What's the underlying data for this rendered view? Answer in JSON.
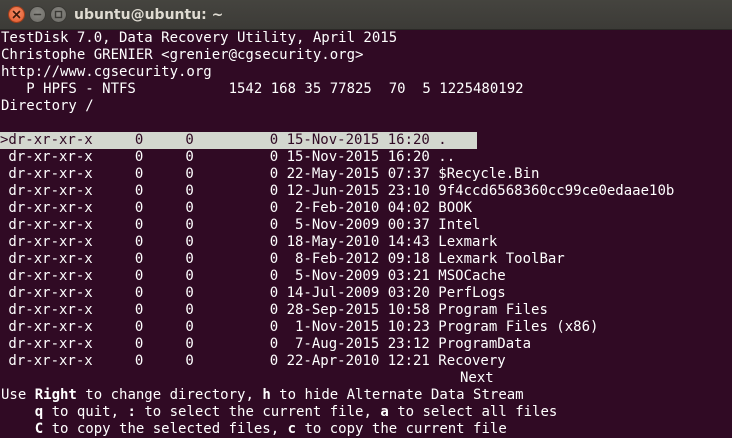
{
  "window": {
    "title": "ubuntu@ubuntu: ~"
  },
  "header": {
    "line1": "TestDisk 7.0, Data Recovery Utility, April 2015",
    "line2": "Christophe GRENIER <grenier@cgsecurity.org>",
    "line3": "http://www.cgsecurity.org",
    "partition": "   P HPFS - NTFS           1542 168 35 77825  70  5 1225480192",
    "directory": "Directory /"
  },
  "listing": [
    {
      "text": ">dr-xr-xr-x     0     0         0 15-Nov-2015 16:20 ."
    },
    {
      "text": " dr-xr-xr-x     0     0         0 15-Nov-2015 16:20 .."
    },
    {
      "text": " dr-xr-xr-x     0     0         0 22-May-2015 07:37 $Recycle.Bin"
    },
    {
      "text": " dr-xr-xr-x     0     0         0 12-Jun-2015 23:10 9f4ccd6568360cc99ce0edaae10b"
    },
    {
      "text": " dr-xr-xr-x     0     0         0  2-Feb-2010 04:02 BOOK"
    },
    {
      "text": " dr-xr-xr-x     0     0         0  5-Nov-2009 00:37 Intel"
    },
    {
      "text": " dr-xr-xr-x     0     0         0 18-May-2010 14:43 Lexmark"
    },
    {
      "text": " dr-xr-xr-x     0     0         0  8-Feb-2012 09:18 Lexmark ToolBar"
    },
    {
      "text": " dr-xr-xr-x     0     0         0  5-Nov-2009 03:21 MSOCache"
    },
    {
      "text": " dr-xr-xr-x     0     0         0 14-Jul-2009 03:20 PerfLogs"
    },
    {
      "text": " dr-xr-xr-x     0     0         0 28-Sep-2015 10:58 Program Files"
    },
    {
      "text": " dr-xr-xr-x     0     0         0  1-Nov-2015 10:23 Program Files (x86)"
    },
    {
      "text": " dr-xr-xr-x     0     0         0  7-Aug-2015 23:12 ProgramData"
    },
    {
      "text": " dr-xr-xr-x     0     0         0 22-Apr-2010 12:21 Recovery"
    }
  ],
  "next": "Next",
  "help": {
    "l1_pre": "Use ",
    "l1_key1": "Right",
    "l1_mid": " to change directory, ",
    "l1_key2": "h",
    "l1_post": " to hide Alternate Data Stream",
    "l2_pre": "    ",
    "l2_key1": "q",
    "l2_mid1": " to quit, ",
    "l2_key2": ":",
    "l2_mid2": " to select the current file, ",
    "l2_key3": "a",
    "l2_post": " to select all files",
    "l3_pre": "    ",
    "l3_key1": "C",
    "l3_mid": " to copy the selected files, ",
    "l3_key2": "c",
    "l3_post": " to copy the current file"
  },
  "colors": {
    "terminal_bg": "#300a24",
    "terminal_fg": "#ffffff",
    "selection_bg": "#d3d7cf",
    "close_button": "#e1582a"
  }
}
